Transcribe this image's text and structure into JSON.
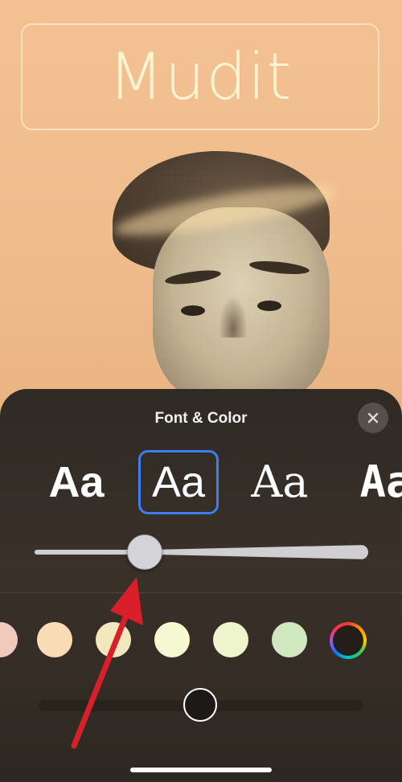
{
  "poster": {
    "name": "Mudit"
  },
  "sheet": {
    "title": "Font & Color",
    "close_icon": "close-icon"
  },
  "fonts": [
    {
      "label": "Aa",
      "selected": false
    },
    {
      "label": "Aa",
      "selected": true
    },
    {
      "label": "Aa",
      "selected": false
    },
    {
      "label": "Aa",
      "selected": false
    }
  ],
  "weight_slider": {
    "value": 0.33
  },
  "colors": {
    "swatches": [
      "#f2c9bd",
      "#f7dcb6",
      "#f3e8bd",
      "#f6f8d2",
      "#eef4cc",
      "#cfe8bf"
    ],
    "accent": "#3d7ff2",
    "annotation_arrow": "#d9202a"
  }
}
